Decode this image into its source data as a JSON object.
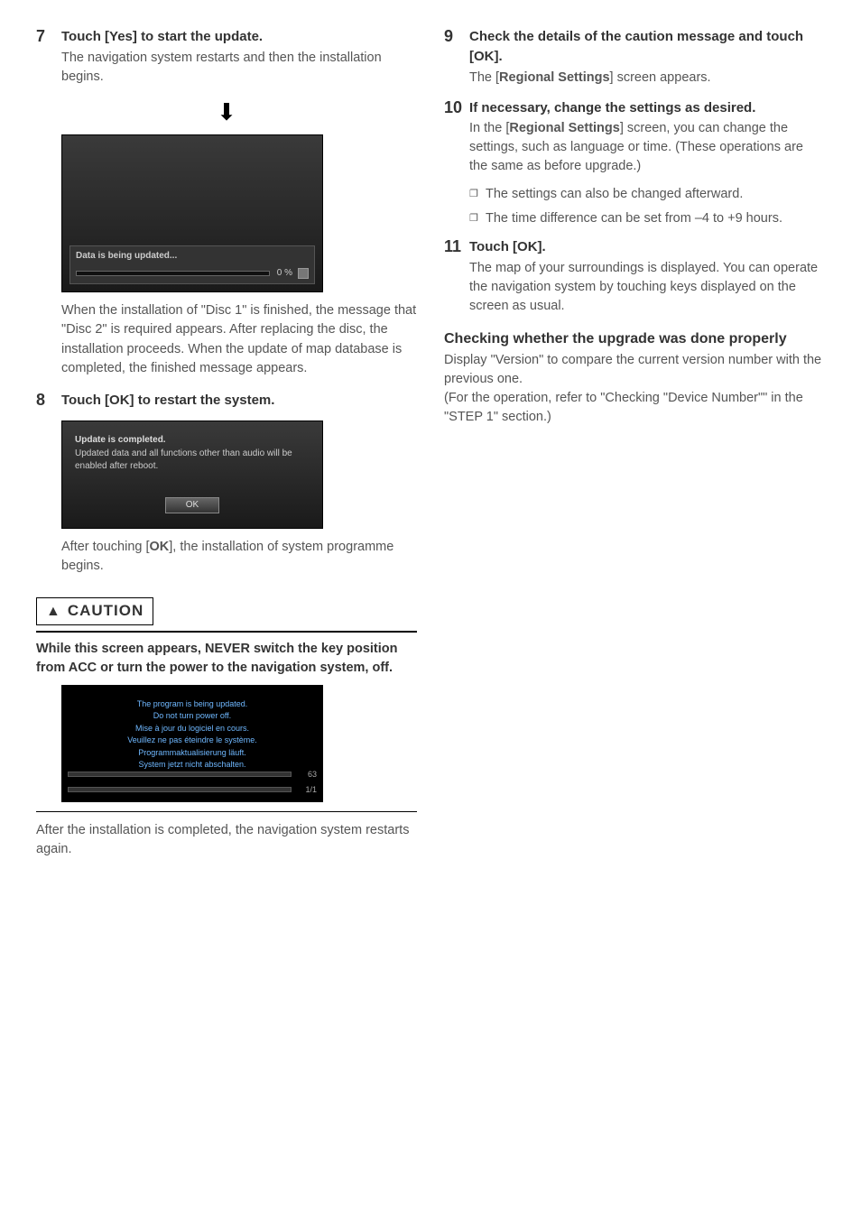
{
  "left": {
    "step7": {
      "num": "7",
      "title": "Touch [Yes] to start the update.",
      "body": "The navigation system restarts and then the installation begins.",
      "screenshot_text": "Data is being updated...",
      "progress": "0 %",
      "after_text": "When the installation of \"Disc 1\" is finished, the message that \"Disc 2\" is required appears. After replacing the disc, the installation proceeds. When the update of map database is completed, the finished message appears."
    },
    "step8": {
      "num": "8",
      "title": "Touch [OK] to restart the system.",
      "screenshot_line1": "Update is completed.",
      "screenshot_line2": "Updated data and all functions other than audio will be enabled after reboot.",
      "ok_btn": "OK",
      "after_text_1": "After touching [",
      "after_text_bold": "OK",
      "after_text_2": "], the installation of system programme begins."
    },
    "caution": {
      "label": "CAUTION",
      "body_1": "While this screen appears, ",
      "body_never": "NEVER",
      "body_2": " switch the key position from ",
      "body_acc": "ACC",
      "body_3": " or turn the power to the navigation system, off.",
      "sc_line1": "The program is being updated.",
      "sc_line2": "Do not turn power off.",
      "sc_line3": "Mise à jour du logiciel en cours.",
      "sc_line4": "Veuillez ne pas éteindre le système.",
      "sc_line5": "Programmaktualisierung läuft.",
      "sc_line6": "System jetzt nicht abschalten.",
      "bar1": "63",
      "bar2": "1/1",
      "after": "After the installation is completed, the navigation system restarts again."
    }
  },
  "right": {
    "step9": {
      "num": "9",
      "title": "Check the details of the caution message and touch [OK].",
      "body_1": "The [",
      "body_bold": "Regional Settings",
      "body_2": "] screen appears."
    },
    "step10": {
      "num": "10",
      "title": "If necessary, change the settings as desired.",
      "body_1": "In the [",
      "body_bold": "Regional Settings",
      "body_2": "] screen, you can change the settings, such as language or time. (These operations are the same as before upgrade.)",
      "bullet1": "The settings can also be changed afterward.",
      "bullet2": "The time difference can be set from –4 to +9 hours."
    },
    "step11": {
      "num": "11",
      "title": "Touch [OK].",
      "body": "The map of your surroundings is displayed. You can operate the navigation system by touching keys displayed on the screen as usual."
    },
    "checking": {
      "heading": "Checking whether the upgrade was done properly",
      "body1": "Display \"Version\" to compare the current version number with the previous one.",
      "body2_a": "(For the operation, refer to \"Checking \"",
      "body2_bold": "Device Number",
      "body2_b": "\"\" in the \"STEP 1\" section.)"
    }
  }
}
